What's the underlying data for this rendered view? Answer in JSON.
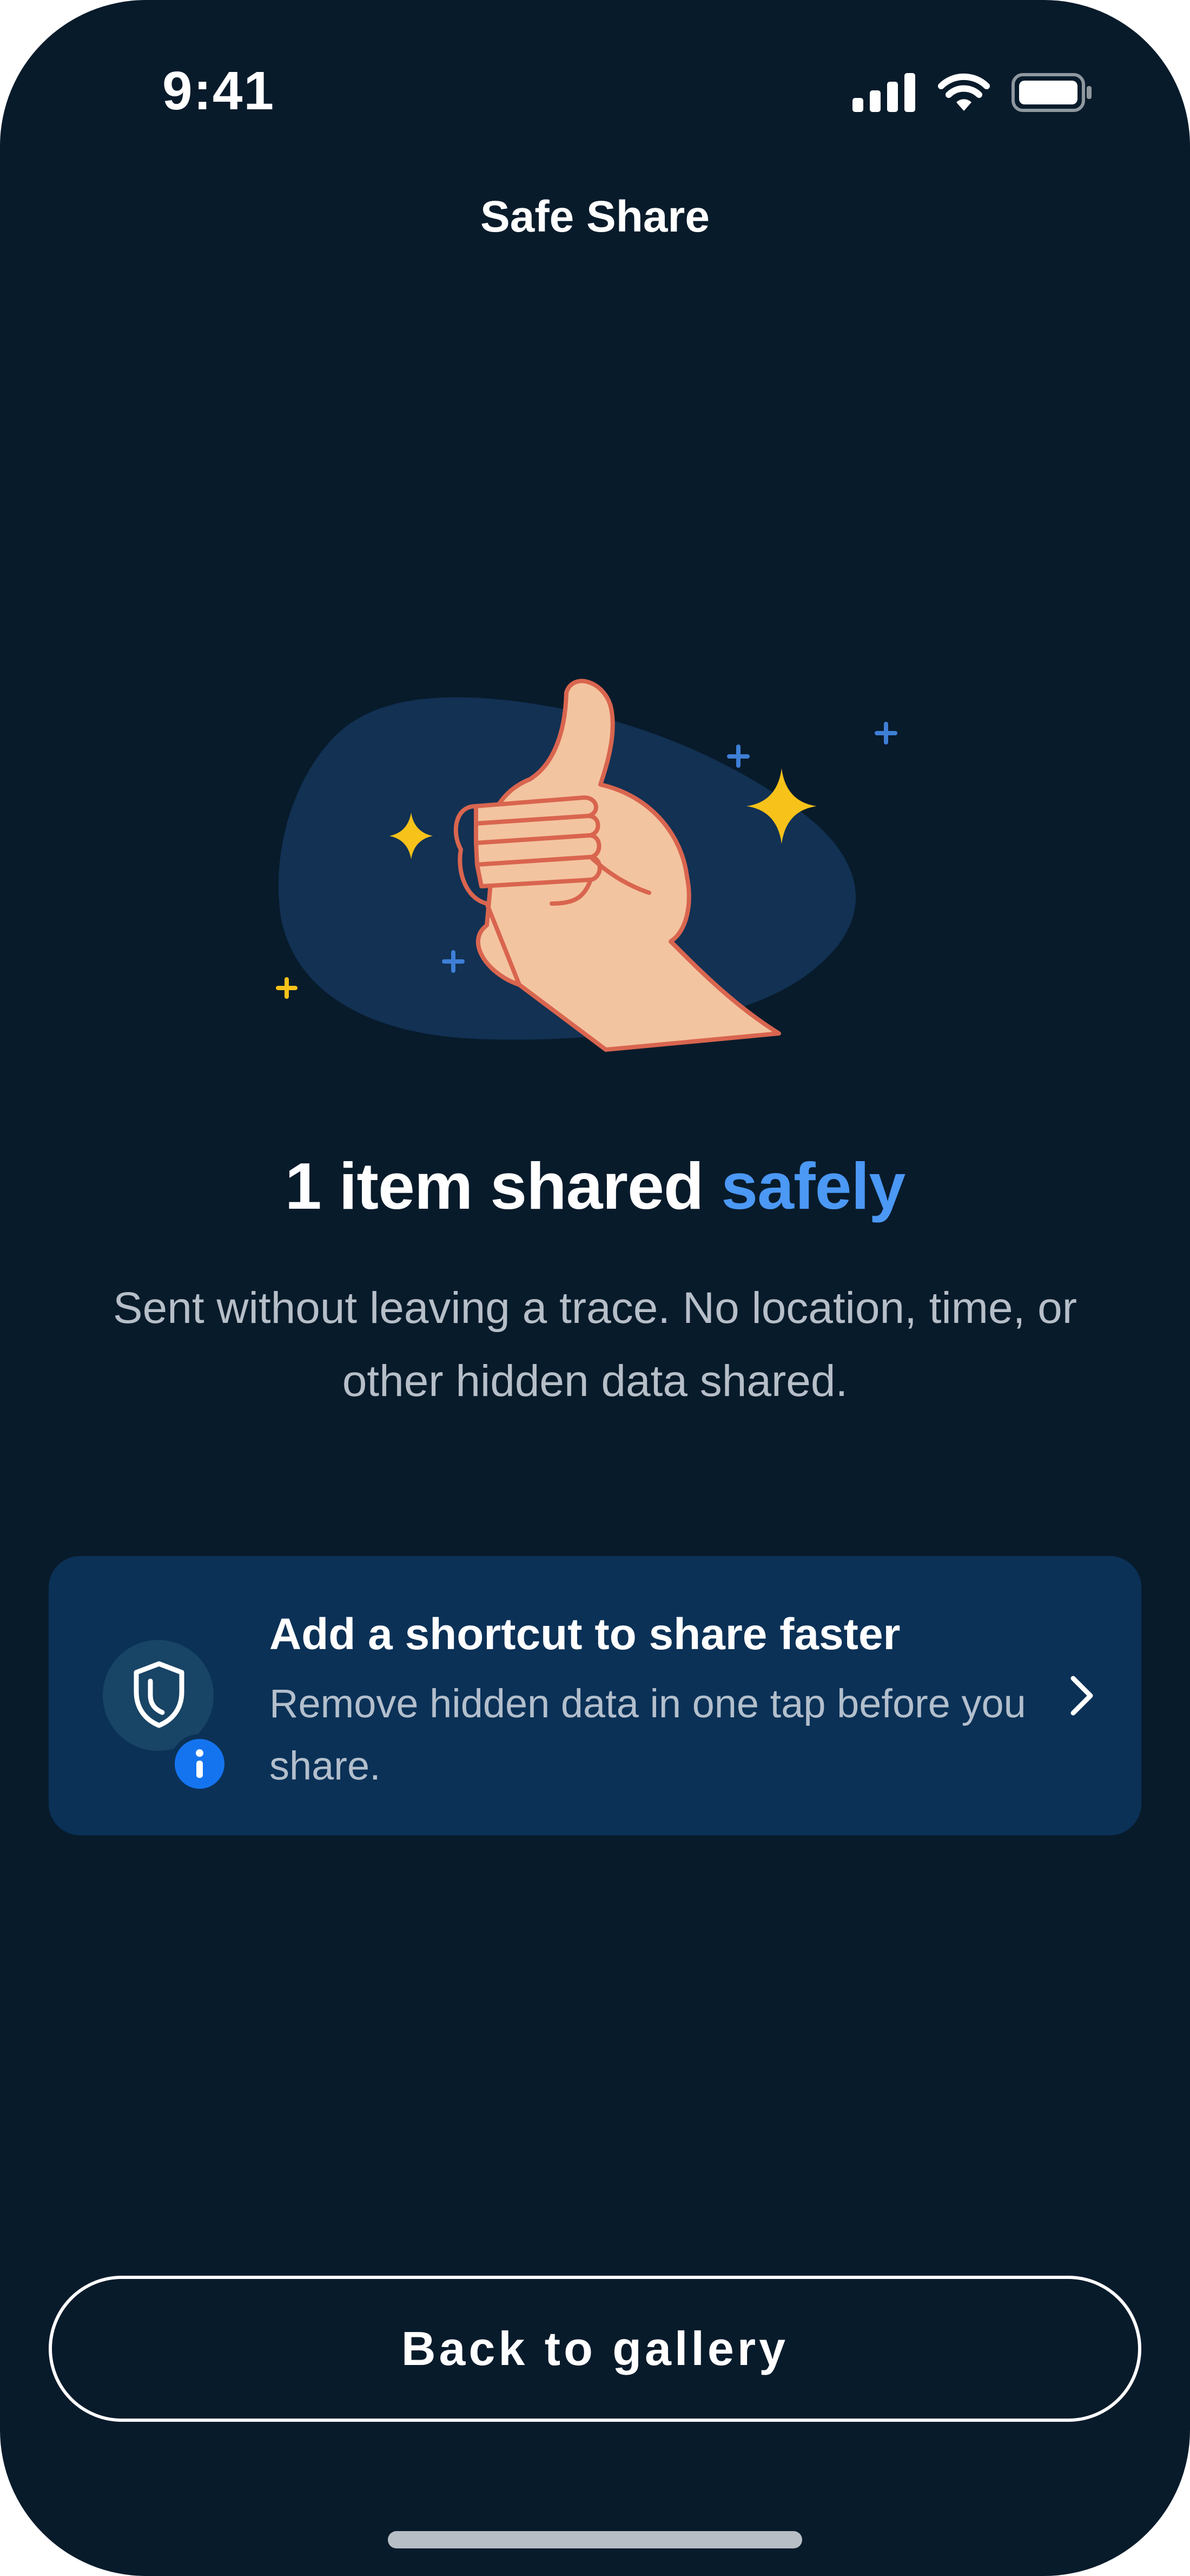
{
  "status_bar": {
    "time": "9:41",
    "icons": [
      "cellular-signal-icon",
      "wifi-icon",
      "battery-icon"
    ]
  },
  "header": {
    "title": "Safe Share"
  },
  "illustration": {
    "icons": [
      "thumbs-up-icon",
      "sparkle-icon",
      "plus-icon"
    ]
  },
  "result": {
    "title_main": "1 item shared",
    "title_accent": "safely",
    "description": "Sent without leaving a trace. No location, time, or other hidden data shared."
  },
  "shortcut_card": {
    "title": "Add a shortcut to share faster",
    "subtitle": "Remove hidden data in one tap before you share.",
    "icons": [
      "shield-icon",
      "info-icon",
      "chevron-right-icon"
    ]
  },
  "footer": {
    "back_button_label": "Back to gallery"
  },
  "colors": {
    "background": "#081b2b",
    "accent": "#4b98f5",
    "card_background": "#0b3157",
    "info_badge": "#1474f0",
    "sparkle_yellow": "#f7c21a",
    "plus_blue": "#3e7fd6",
    "hand_skin": "#f3c4a0",
    "hand_outline": "#d9654f"
  }
}
